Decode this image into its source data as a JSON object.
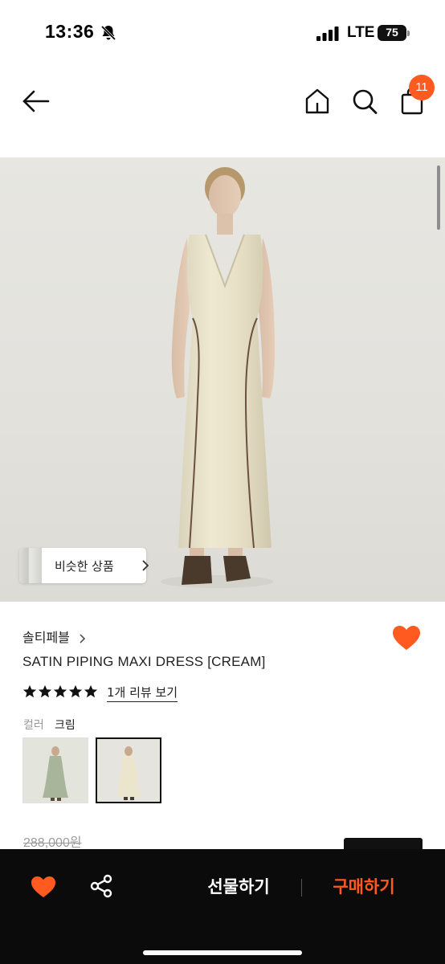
{
  "status_bar": {
    "time": "13:36",
    "network": "LTE",
    "battery": "75"
  },
  "nav": {
    "cart_count": "11"
  },
  "hero": {
    "similar_label": "비슷한 상품"
  },
  "product": {
    "brand": "솔티페블",
    "title": "SATIN PIPING MAXI DRESS [CREAM]",
    "rating": 5,
    "review_link": "1개 리뷰 보기",
    "color_label": "컬러",
    "color_value": "크림",
    "original_price": "288,000원"
  },
  "bottom_bar": {
    "gift_label": "선물하기",
    "buy_label": "구매하기"
  },
  "colors": {
    "accent": "#ff5a1f",
    "bar_bg": "#0b0b0b"
  },
  "icons": [
    "back-arrow-icon",
    "home-icon",
    "search-icon",
    "shopping-bag-icon",
    "heart-icon",
    "share-icon",
    "star-icon",
    "chevron-right-icon",
    "bell-slash-icon"
  ]
}
